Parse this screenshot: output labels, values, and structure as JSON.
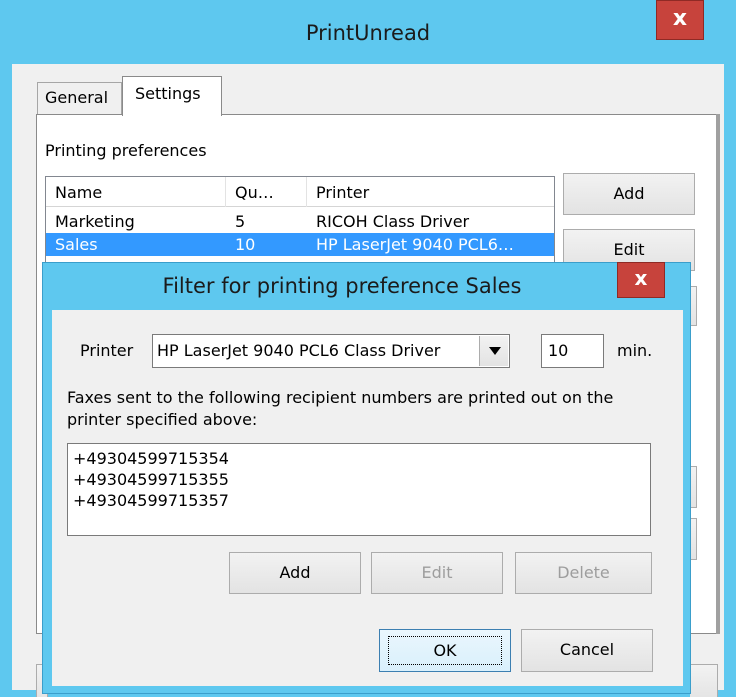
{
  "main_window": {
    "title": "PrintUnread",
    "close_glyph": "x",
    "tabs": [
      "General",
      "Settings"
    ],
    "active_tab": "Settings",
    "section_label": "Printing preferences",
    "list": {
      "columns": [
        "Name",
        "Qu…",
        "Printer"
      ],
      "rows": [
        {
          "name": "Marketing",
          "interval": "5",
          "printer": "RICOH Class Driver",
          "selected": false
        },
        {
          "name": "Sales",
          "interval": "10",
          "printer": "HP LaserJet 9040 PCL6…",
          "selected": true
        }
      ]
    },
    "buttons": {
      "add": "Add",
      "edit": "Edit"
    }
  },
  "dialog": {
    "title": "Filter for printing preference Sales",
    "close_glyph": "x",
    "printer_label": "Printer",
    "printer_value": "HP LaserJet 9040 PCL6 Class Driver",
    "interval_value": "10",
    "interval_unit": "min.",
    "description": "Faxes sent to the following recipient numbers are printed out on the printer specified above:",
    "numbers": [
      "+49304599715354",
      "+49304599715355",
      "+49304599715357"
    ],
    "buttons": {
      "add": "Add",
      "edit": "Edit",
      "delete": "Delete",
      "ok": "OK",
      "cancel": "Cancel"
    }
  },
  "colors": {
    "title_bar": "#5ec8ef",
    "close_button": "#c7433c",
    "selection": "#3399ff"
  }
}
